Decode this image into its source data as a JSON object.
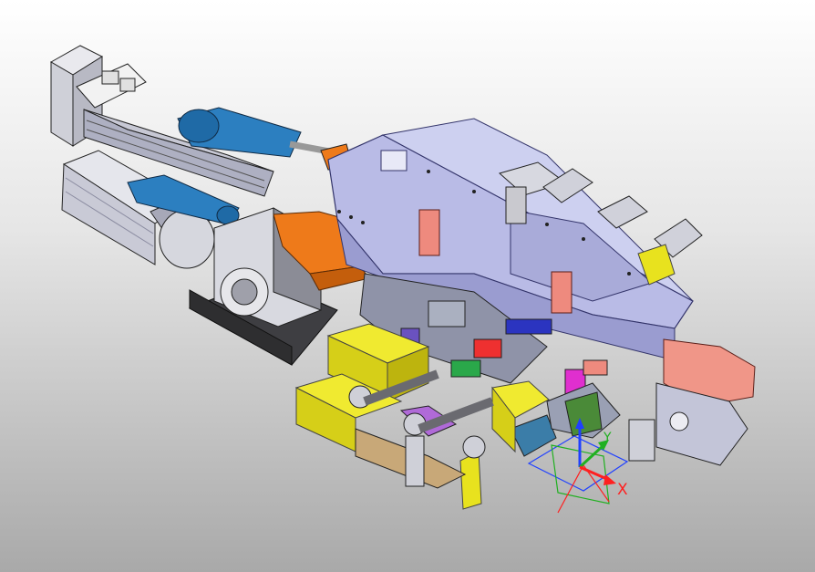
{
  "viewport": {
    "background_top": "#ffffff",
    "background_bottom": "#a9a9a9"
  },
  "axes": {
    "x_label": "X",
    "y_label": "Y",
    "x_color": "#ff2020",
    "y_color": "#20b020",
    "z_color": "#2040ff"
  },
  "colors": {
    "frame": "#b9bbe6",
    "frame_dark": "#6e70a8",
    "motor": "#d9d9dc",
    "actuator_blue": "#2c7fc0",
    "accent_orange": "#ee7a1a",
    "cylinder_yellow": "#e8e21e",
    "block_salmon": "#ee8a7e",
    "base_dark": "#4a4a4c"
  }
}
